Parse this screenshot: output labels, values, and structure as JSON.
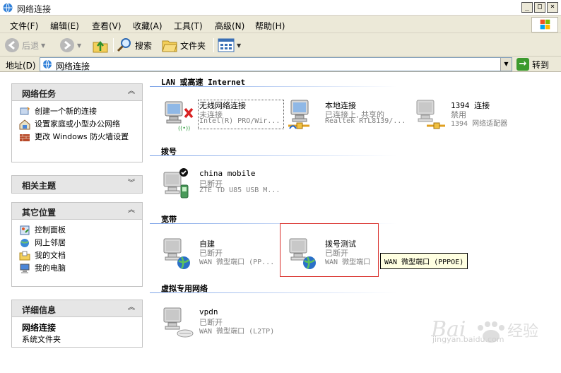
{
  "window": {
    "title": "网络连接"
  },
  "menu": {
    "items": [
      "文件(F)",
      "编辑(E)",
      "查看(V)",
      "收藏(A)",
      "工具(T)",
      "高级(N)",
      "帮助(H)"
    ]
  },
  "toolbar": {
    "back_label": "后退",
    "search_label": "搜索",
    "folders_label": "文件夹"
  },
  "address": {
    "label": "地址(D)",
    "value": "网络连接",
    "go_label": "转到"
  },
  "sidebar": {
    "network_tasks": {
      "title": "网络任务",
      "items": [
        "创建一个新的连接",
        "设置家庭或小型办公网络",
        "更改 Windows 防火墙设置"
      ]
    },
    "related": {
      "title": "相关主题"
    },
    "other_places": {
      "title": "其它位置",
      "items": [
        "控制面板",
        "网上邻居",
        "我的文档",
        "我的电脑"
      ]
    },
    "details": {
      "title": "详细信息",
      "name": "网络连接",
      "type": "系统文件夹"
    }
  },
  "groups": {
    "lan": {
      "title": "LAN 或高速 Internet",
      "items": [
        {
          "name": "无线网络连接",
          "status": "未连接",
          "device": "Intel(R) PRO/Wir..."
        },
        {
          "name": "本地连接",
          "status": "已连接上, 共享的",
          "device": "Realtek RTL8139/..."
        },
        {
          "name": "1394 连接",
          "status": "禁用",
          "device": "1394 网络适配器"
        }
      ]
    },
    "dialup": {
      "title": "拨号",
      "items": [
        {
          "name": "china mobile",
          "status": "已断开",
          "device": "ZTE TD U85 USB M..."
        }
      ]
    },
    "broadband": {
      "title": "宽带",
      "items": [
        {
          "name": "自建",
          "status": "已断开",
          "device": "WAN 微型端口 (PP..."
        },
        {
          "name": "拨号测试",
          "status": "已断开",
          "device": "WAN 微型端口"
        }
      ]
    },
    "vpn": {
      "title": "虚拟专用网络",
      "items": [
        {
          "name": "vpdn",
          "status": "已断开",
          "device": "WAN 微型端口 (L2TP)"
        }
      ]
    }
  },
  "tooltip": "WAN 微型端口 (PPPOE)",
  "watermark": {
    "brand": "Baidu 经验",
    "url": "jingyan.baidu.com"
  }
}
